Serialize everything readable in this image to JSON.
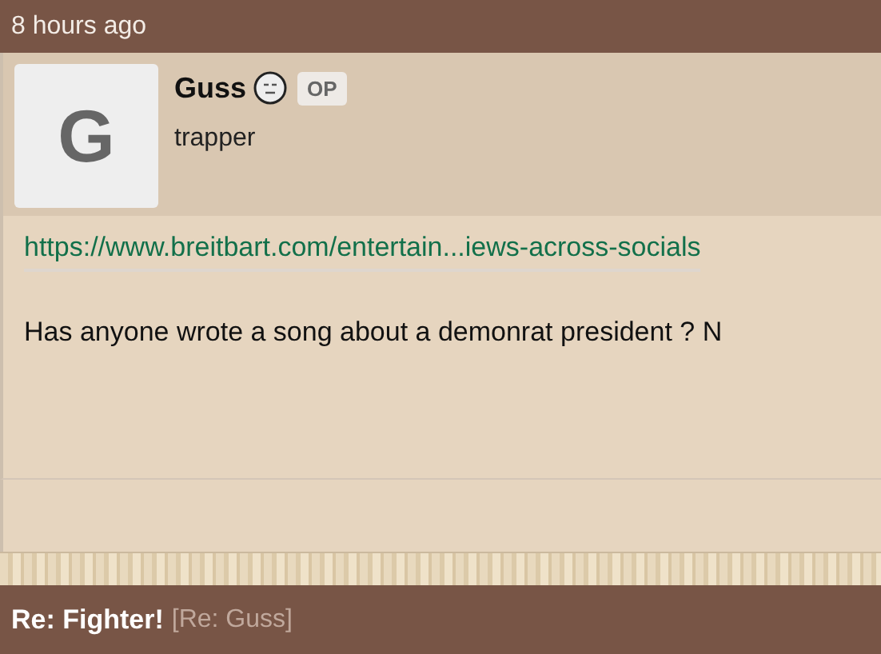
{
  "post_header": {
    "time": "8 hours ago"
  },
  "post": {
    "avatar_letter": "G",
    "author": "Guss",
    "badge": "OP",
    "user_title": "trapper",
    "link": "https://www.breitbart.com/entertain...iews-across-socials",
    "body": "Has anyone wrote a song about a demonrat president ? N"
  },
  "next_post": {
    "title": "Re: Fighter!",
    "reply_to": "[Re: Guss]"
  }
}
